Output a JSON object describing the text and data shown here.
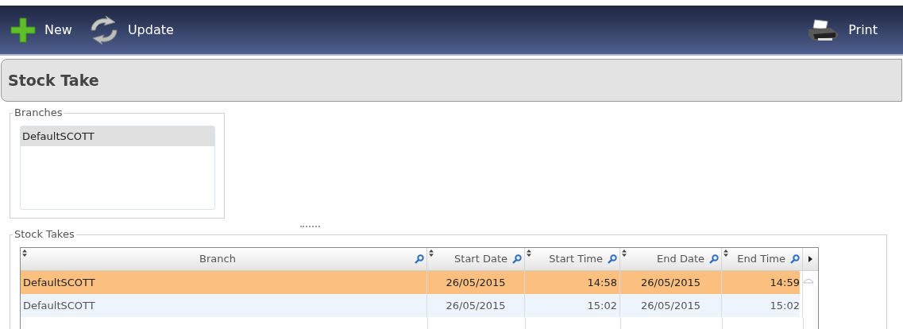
{
  "toolbar": {
    "buttons": [
      {
        "kind": "new",
        "label": "New"
      },
      {
        "kind": "update",
        "label": "Update"
      },
      {
        "kind": "print",
        "label": "Print"
      }
    ]
  },
  "page_title": "Stock Take",
  "branches": {
    "title": "Branches",
    "items": [
      {
        "label": "DefaultSCOTT",
        "selected": true
      }
    ]
  },
  "stock_takes": {
    "title": "Stock Takes",
    "columns": [
      {
        "label": "Branch"
      },
      {
        "label": "Start Date"
      },
      {
        "label": "Start Time"
      },
      {
        "label": "End Date"
      },
      {
        "label": "End Time"
      }
    ],
    "rows": [
      {
        "selected": true,
        "cells": [
          "DefaultSCOTT",
          "26/05/2015",
          "14:58",
          "26/05/2015",
          "14:59"
        ]
      },
      {
        "selected": false,
        "cells": [
          "DefaultSCOTT",
          "26/05/2015",
          "15:02",
          "26/05/2015",
          "15:02"
        ]
      }
    ]
  }
}
